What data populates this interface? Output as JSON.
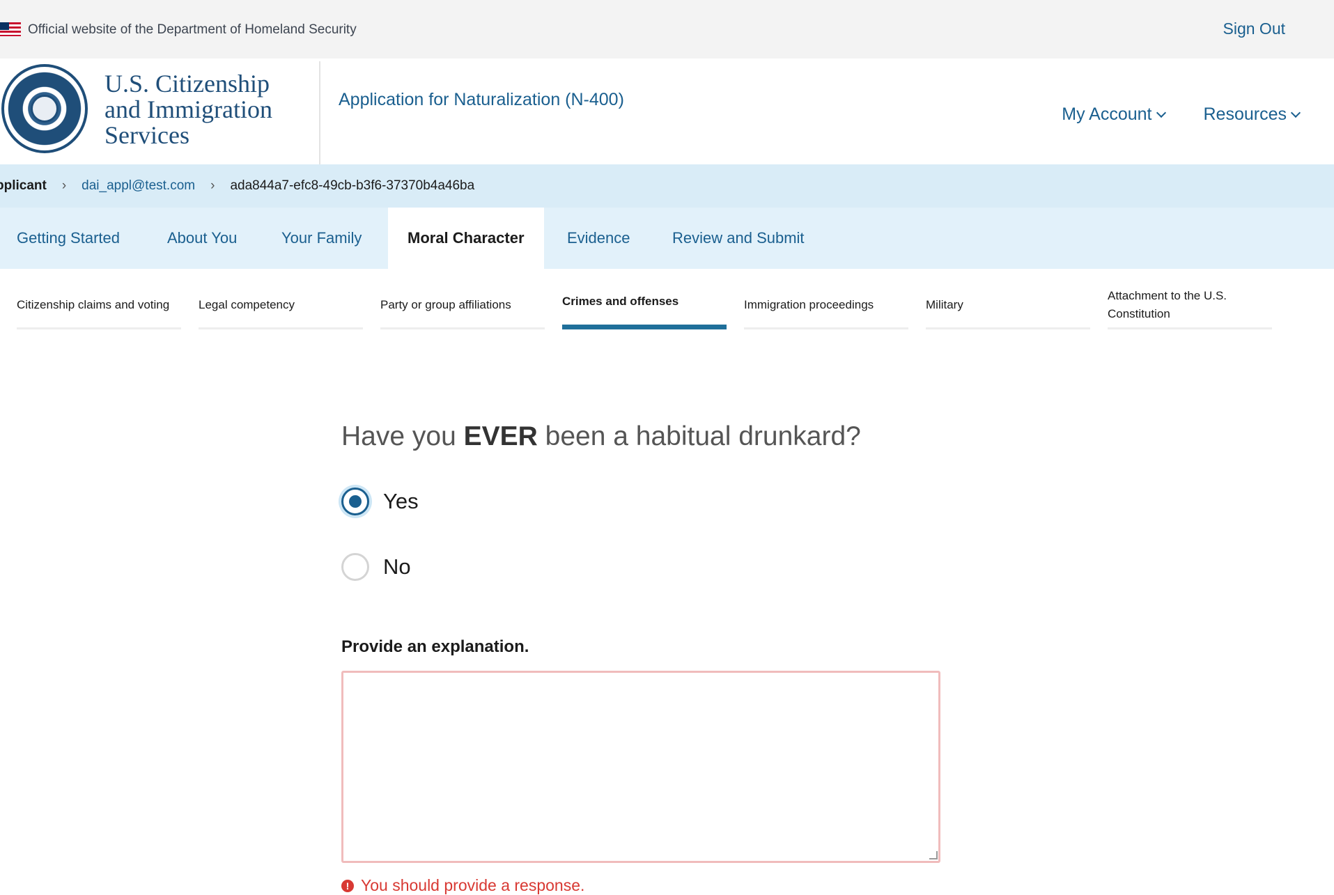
{
  "banner": {
    "official_text": "Official website of the Department of Homeland Security",
    "sign_out": "Sign Out"
  },
  "header": {
    "agency_line1": "U.S. Citizenship",
    "agency_line2": "and Immigration",
    "agency_line3": "Services",
    "app_title": "Application for Naturalization (N-400)",
    "nav": [
      {
        "label": "My Account"
      },
      {
        "label": "Resources"
      }
    ]
  },
  "breadcrumb": {
    "items": [
      "pplicant",
      "dai_appl@test.com",
      "ada844a7-efc8-49cb-b3f6-37370b4a46ba"
    ]
  },
  "tabs": [
    {
      "label": "Getting Started"
    },
    {
      "label": "About You"
    },
    {
      "label": "Your Family"
    },
    {
      "label": "Moral Character",
      "active": true
    },
    {
      "label": "Evidence"
    },
    {
      "label": "Review and Submit"
    }
  ],
  "subtabs": [
    {
      "label": "Citizenship claims and voting"
    },
    {
      "label": "Legal competency"
    },
    {
      "label": "Party or group affiliations"
    },
    {
      "label": "Crimes and offenses",
      "active": true
    },
    {
      "label": "Immigration proceedings"
    },
    {
      "label": "Military"
    },
    {
      "label": "Attachment to the U.S. Constitution"
    }
  ],
  "question": {
    "prefix": "Have you ",
    "emphasis": "EVER",
    "suffix": " been a habitual drunkard?",
    "options": [
      {
        "label": "Yes",
        "selected": true
      },
      {
        "label": "No",
        "selected": false
      }
    ]
  },
  "explanation": {
    "label": "Provide an explanation.",
    "value": "",
    "error": "You should provide a response."
  },
  "colors": {
    "link": "#1a5f8f",
    "error": "#d83933",
    "breadcrumb_bg": "#d9ecf7",
    "tabs_bg": "#e2f1fa"
  }
}
